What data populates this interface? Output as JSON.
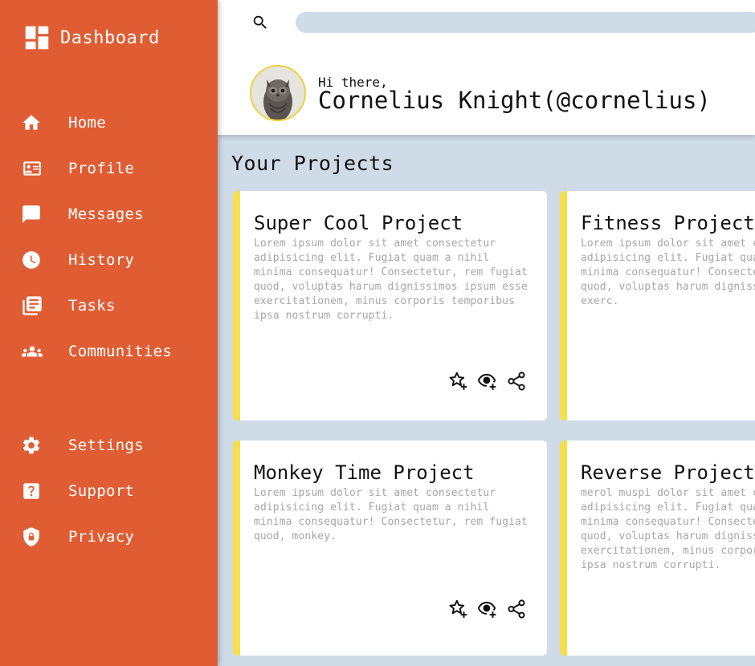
{
  "sidebar": {
    "brand": {
      "label": "Dashboard",
      "icon": "dashboard-icon"
    },
    "items": [
      {
        "label": "Home",
        "icon": "home-icon"
      },
      {
        "label": "Profile",
        "icon": "profile-card-icon"
      },
      {
        "label": "Messages",
        "icon": "message-icon"
      },
      {
        "label": "History",
        "icon": "clock-icon"
      },
      {
        "label": "Tasks",
        "icon": "tasks-icon"
      },
      {
        "label": "Communities",
        "icon": "people-icon"
      }
    ],
    "bottom_items": [
      {
        "label": "Settings",
        "icon": "gear-icon"
      },
      {
        "label": "Support",
        "icon": "help-icon"
      },
      {
        "label": "Privacy",
        "icon": "shield-lock-icon"
      }
    ]
  },
  "header": {
    "search": {
      "placeholder": "",
      "value": "",
      "icon": "search-icon"
    },
    "greeting": "Hi there,",
    "username": "Cornelius Knight(@cornelius)"
  },
  "main": {
    "section_title": "Your Projects",
    "projects": [
      {
        "title": "Super Cool Project",
        "description": "Lorem ipsum dolor sit amet consectetur adipisicing elit. Fugiat quam a nihil minima consequatur! Consectetur, rem fugiat quod, voluptas harum dignissimos ipsum esse exercitationem, minus corporis temporibus ipsa nostrum corrupti.",
        "actions": [
          "star-plus-icon",
          "eye-plus-icon",
          "share-icon"
        ]
      },
      {
        "title": "Fitness Project",
        "description": "Lorem ipsum dolor sit amet consectetur adipisicing elit. Fugiat quam a nihil minima consequatur! Consectetur, rem fugiat quod, voluptas harum dignissimos ipsum esse exerc.",
        "actions": []
      },
      {
        "title": "Monkey Time Project",
        "description": "Lorem ipsum dolor sit amet consectetur adipisicing elit. Fugiat quam a nihil minima consequatur! Consectetur, rem fugiat quod, monkey.",
        "actions": [
          "star-plus-icon",
          "eye-plus-icon",
          "share-icon"
        ]
      },
      {
        "title": "Reverse Project",
        "description": "merol muspi dolor sit amet consectetur adipisicing elit. Fugiat quam a nihil minima consequatur! Consectetur, rem fugiat quod, voluptas harum dignissimos ipsum esse exercitationem, minus corporis temporibus ipsa nostrum corrupti.",
        "actions": []
      }
    ]
  },
  "colors": {
    "sidebar": "#e05d34",
    "accent": "#f7de4d",
    "background": "#cfdbe7"
  }
}
